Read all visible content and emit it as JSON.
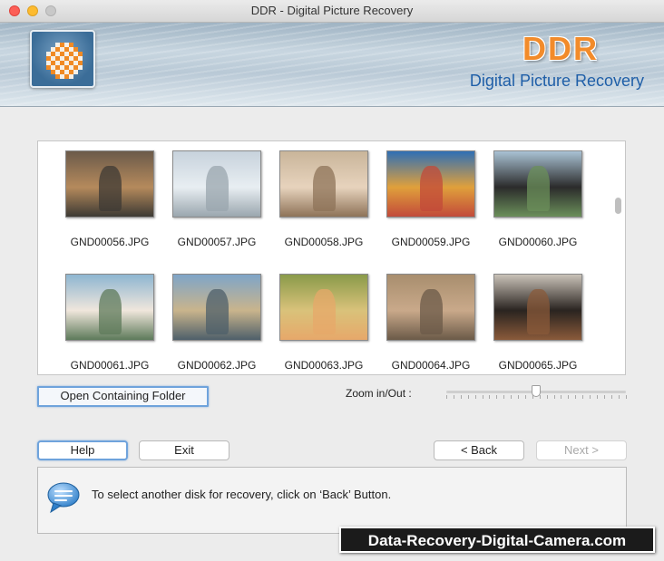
{
  "window": {
    "title": "DDR - Digital Picture Recovery"
  },
  "header": {
    "brand": "DDR",
    "subtitle": "Digital Picture Recovery",
    "brand_color": "#f28b2a",
    "subtitle_color": "#1f5fa8"
  },
  "gallery": {
    "items": [
      {
        "name": "GND00056.JPG"
      },
      {
        "name": "GND00057.JPG"
      },
      {
        "name": "GND00058.JPG"
      },
      {
        "name": "GND00059.JPG"
      },
      {
        "name": "GND00060.JPG"
      },
      {
        "name": "GND00061.JPG"
      },
      {
        "name": "GND00062.JPG"
      },
      {
        "name": "GND00063.JPG"
      },
      {
        "name": "GND00064.JPG"
      },
      {
        "name": "GND00065.JPG"
      }
    ]
  },
  "actions": {
    "open_folder_label": "Open Containing Folder",
    "zoom_label": "Zoom in/Out :",
    "zoom_level": 0.5
  },
  "nav": {
    "help_label": "Help",
    "exit_label": "Exit",
    "back_label": "< Back",
    "next_label": "Next >"
  },
  "info": {
    "message": "To select another disk for recovery, click on ‘Back’ Button.",
    "icon": "speech-bubble-icon"
  },
  "watermark": {
    "text": "Data-Recovery-Digital-Camera.com"
  }
}
